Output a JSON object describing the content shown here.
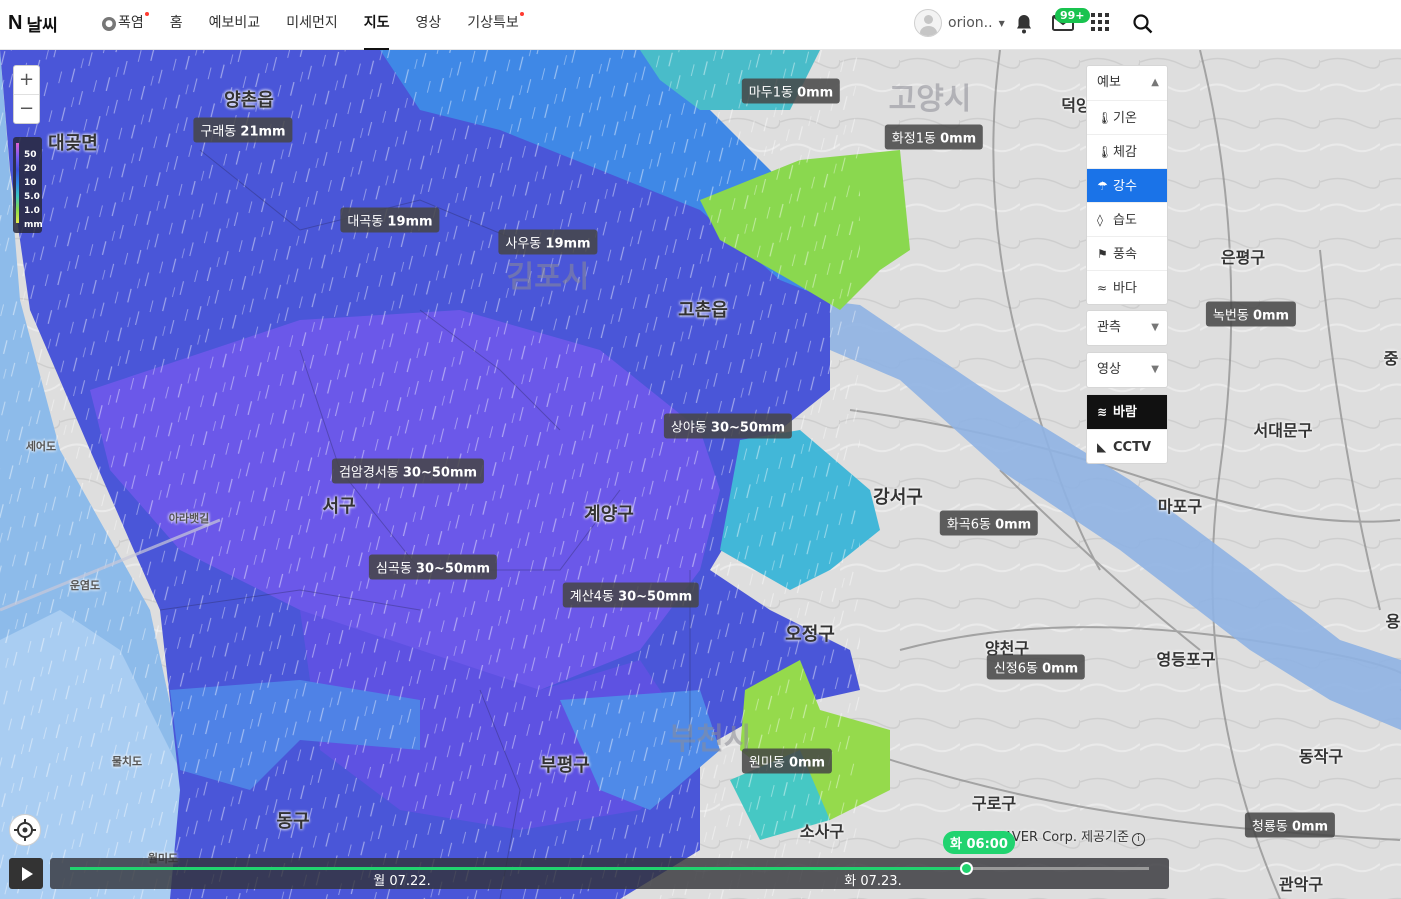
{
  "header": {
    "brand_mark": "N",
    "brand_title": "날씨",
    "nav": [
      {
        "label": "폭염",
        "alert": true
      },
      {
        "label": "홈",
        "alert": false
      },
      {
        "label": "예보비교",
        "alert": false
      },
      {
        "label": "미세먼지",
        "alert": false
      },
      {
        "label": "지도",
        "alert": false,
        "active": true
      },
      {
        "label": "영상",
        "alert": false
      },
      {
        "label": "기상특보",
        "alert": true
      }
    ],
    "user_name": "orion..",
    "mail_badge": "99+"
  },
  "map": {
    "zoom_in": "+",
    "zoom_out": "−",
    "legend": {
      "ticks": [
        "50",
        "20",
        "10",
        "5.0",
        "1.0",
        "mm"
      ]
    },
    "places": {
      "yangchon": "양촌읍",
      "daegot": "대곶면",
      "gimpo": "김포시",
      "gochon": "고촌읍",
      "goyang": "고양시",
      "deogyang": "덕양",
      "eunpyeong": "은평구",
      "seodaemun": "서대문구",
      "jung": "중",
      "mapo": "마포구",
      "gangseo": "강서구",
      "seo": "서구",
      "gyeyang": "계양구",
      "ojeong": "오정구",
      "yangcheon": "양천구",
      "yeongdeungpo": "영등포구",
      "bucheon": "부천시",
      "bupyeong": "부평구",
      "dong": "동구",
      "guro": "구로구",
      "dongjak": "동작구",
      "gwanak": "관악구",
      "sosa": "소사구",
      "seeodo": "세어도",
      "ara": "아라뱃길",
      "unyeom": "운염도",
      "muljido": "물치도",
      "wolmi": "월미도",
      "yong": "용"
    },
    "labels": [
      {
        "place": "마두1동",
        "value": "0mm"
      },
      {
        "place": "구래동",
        "value": "21mm"
      },
      {
        "place": "화정1동",
        "value": "0mm"
      },
      {
        "place": "대곡동",
        "value": "19mm"
      },
      {
        "place": "사우동",
        "value": "19mm"
      },
      {
        "place": "녹번동",
        "value": "0mm"
      },
      {
        "place": "상야동",
        "value": "30~50mm"
      },
      {
        "place": "검암경서동",
        "value": "30~50mm"
      },
      {
        "place": "화곡6동",
        "value": "0mm"
      },
      {
        "place": "심곡동",
        "value": "30~50mm"
      },
      {
        "place": "계산4동",
        "value": "30~50mm"
      },
      {
        "place": "신정6동",
        "value": "0mm"
      },
      {
        "place": "원미동",
        "value": "0mm"
      },
      {
        "place": "청룡동",
        "value": "0mm"
      }
    ]
  },
  "panel_forecast": {
    "header": "예보",
    "items": [
      {
        "icon": "thermometer-icon",
        "label": "기온"
      },
      {
        "icon": "feels-like-icon",
        "label": "체감"
      },
      {
        "icon": "umbrella-icon",
        "label": "강수",
        "selected": true
      },
      {
        "icon": "droplet-icon",
        "label": "습도"
      },
      {
        "icon": "wind-flag-icon",
        "label": "풍속"
      },
      {
        "icon": "wave-icon",
        "label": "바다"
      }
    ]
  },
  "panel_observe": {
    "label": "관측"
  },
  "panel_video": {
    "label": "영상"
  },
  "panel_extra": [
    {
      "icon": "wind-icon",
      "label": "바람"
    },
    {
      "icon": "cctv-icon",
      "label": "CCTV"
    }
  ],
  "timeline": {
    "day1": "월 07.22.",
    "day2": "화 07.23.",
    "current": "화 06:00",
    "progress": 0.83
  },
  "credit": {
    "text": "© NAVER Corp. 제공기준"
  }
}
